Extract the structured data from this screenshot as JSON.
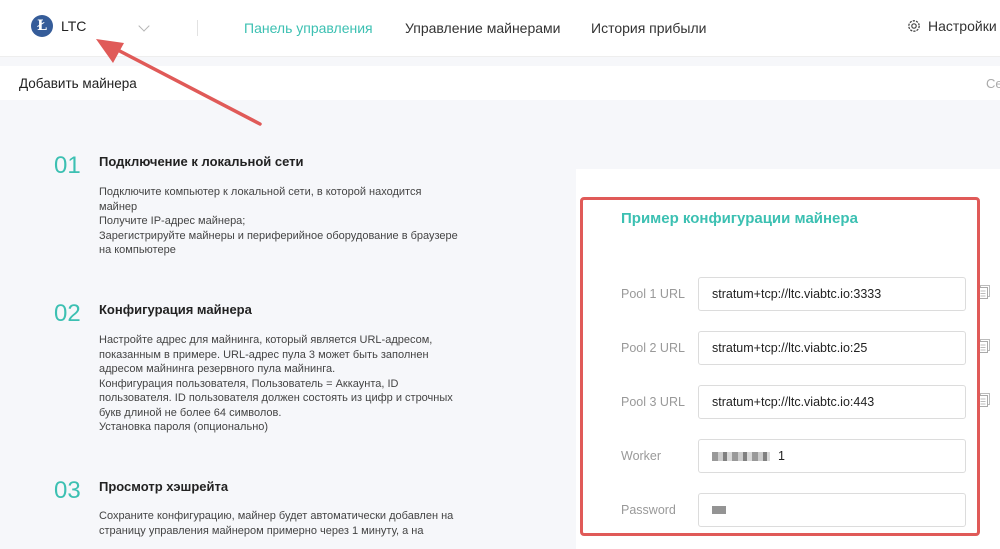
{
  "topbar": {
    "coin": {
      "logo_letter": "Ł",
      "name": "LTC"
    },
    "nav": [
      {
        "label": "Панель управления",
        "active": true
      },
      {
        "label": "Управление майнерами",
        "active": false
      },
      {
        "label": "История прибыли",
        "active": false
      }
    ],
    "settings_label": "Настройки м"
  },
  "subbar": {
    "title": "Добавить майнера",
    "edge_text": "Се"
  },
  "steps": [
    {
      "number": "01",
      "title": "Подключение к локальной сети",
      "lines": [
        "Подключите компьютер к локальной сети, в которой находится",
        "майнер",
        "Получите IP-адрес майнера;",
        "Зарегистрируйте майнеры и периферийное оборудование в браузере",
        "на компьютере"
      ]
    },
    {
      "number": "02",
      "title": "Конфигурация майнера",
      "lines": [
        "Настройте адрес для майнинга, который является URL-адресом,",
        "показанным в примере. URL-адрес пула 3 может быть заполнен",
        "адресом майнинга резервного пула майнинга.",
        "Конфигурация пользователя, Пользователь = Аккаунта, ID",
        "пользователя. ID пользователя должен состоять из цифр и строчных",
        "букв длиной не более 64 символов.",
        "Установка пароля (опционально)"
      ]
    },
    {
      "number": "03",
      "title": "Просмотр хэшрейта",
      "lines": [
        "Сохраните конфигурацию, майнер будет автоматически добавлен на",
        "страницу управления майнером примерно через 1 минуту, а на"
      ]
    }
  ],
  "config": {
    "title": "Пример конфигурации майнера",
    "fields": [
      {
        "label": "Pool 1 URL",
        "value": "stratum+tcp://ltc.viabtc.io:3333"
      },
      {
        "label": "Pool 2 URL",
        "value": "stratum+tcp://ltc.viabtc.io:25"
      },
      {
        "label": "Pool 3 URL",
        "value": "stratum+tcp://ltc.viabtc.io:443"
      },
      {
        "label": "Worker",
        "value": "1"
      },
      {
        "label": "Password",
        "value": ""
      }
    ]
  },
  "colors": {
    "accent": "#3cc0b2",
    "highlight": "#e05a58",
    "coin_logo": "#355c99"
  },
  "icons": {
    "coin": "litecoin-logo-icon",
    "dropdown": "chevron-down-icon",
    "settings": "gear-icon",
    "copy": "copy-icon"
  }
}
